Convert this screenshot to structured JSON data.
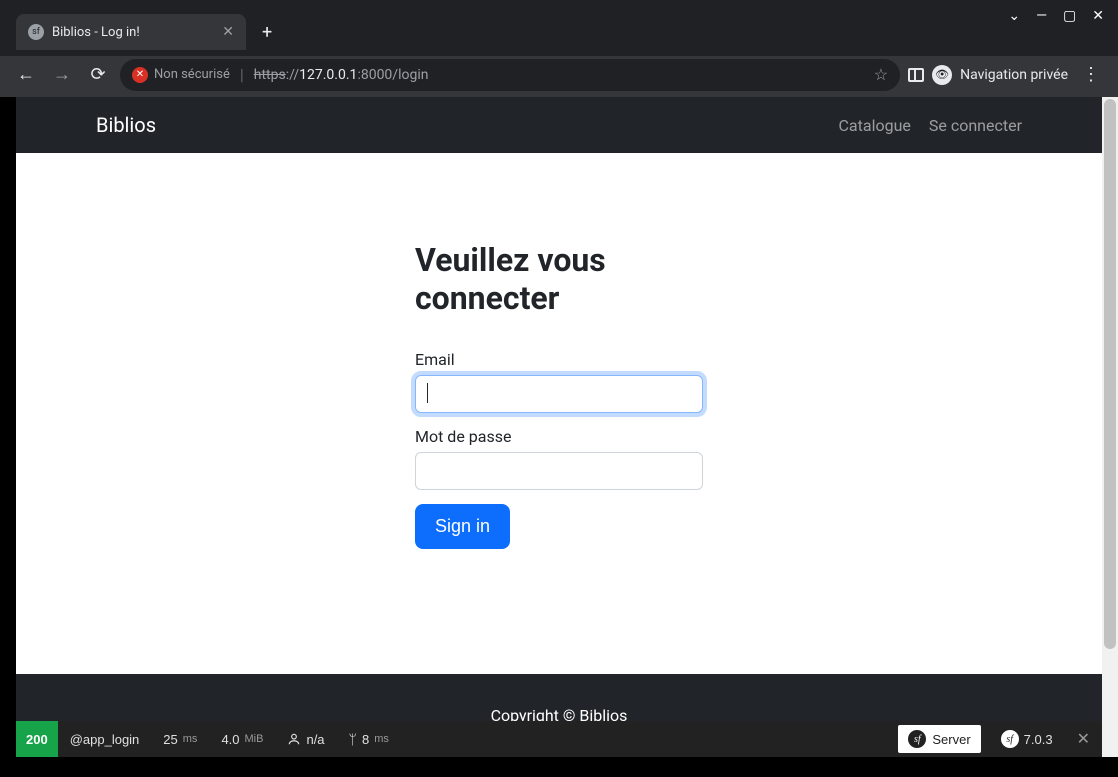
{
  "browser": {
    "tab_title": "Biblios - Log in!",
    "security_label": "Non sécurisé",
    "url_scheme_strike": "https",
    "url_scheme_rest": "://",
    "url_host": "127.0.0.1",
    "url_port_path": ":8000/login",
    "private_label": "Navigation privée"
  },
  "nav": {
    "brand": "Biblios",
    "links": [
      "Catalogue",
      "Se connecter"
    ]
  },
  "form": {
    "title": "Veuillez vous connecter",
    "email_label": "Email",
    "password_label": "Mot de passe",
    "submit_label": "Sign in"
  },
  "footer": {
    "text": "Copyright © Biblios"
  },
  "debug": {
    "status": "200",
    "route": "@app_login",
    "time_val": "25",
    "time_unit": "ms",
    "mem_val": "4.0",
    "mem_unit": "MiB",
    "user": "n/a",
    "twig_val": "8",
    "twig_unit": "ms",
    "server_label": "Server",
    "sf_version": "7.0.3"
  }
}
